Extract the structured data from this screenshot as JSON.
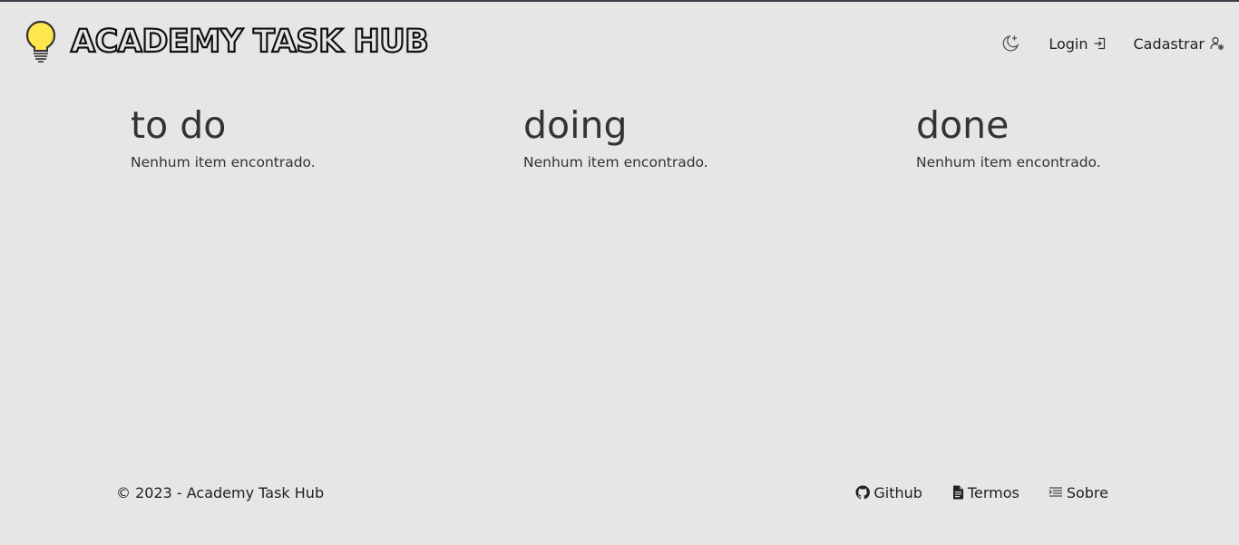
{
  "header": {
    "brand_title": "ACADEMY TASK HUB",
    "logo_icon": "lightbulb-icon",
    "theme_toggle_icon": "moon-stars-icon",
    "nav": {
      "login_label": "Login",
      "login_icon": "login-icon",
      "register_label": "Cadastrar",
      "register_icon": "user-gear-icon"
    }
  },
  "board": {
    "columns": [
      {
        "title": "to do",
        "empty_text": "Nenhum item encontrado."
      },
      {
        "title": "doing",
        "empty_text": "Nenhum item encontrado."
      },
      {
        "title": "done",
        "empty_text": "Nenhum item encontrado."
      }
    ]
  },
  "footer": {
    "copyright": "© 2023 - Academy Task Hub",
    "links": [
      {
        "label": "Github",
        "icon": "github-icon"
      },
      {
        "label": "Termos",
        "icon": "document-icon"
      },
      {
        "label": "Sobre",
        "icon": "list-icon"
      }
    ]
  },
  "colors": {
    "background": "#e6e6e6",
    "top_border": "#3a3f47",
    "text": "#333333",
    "bulb": "#fde74c"
  }
}
